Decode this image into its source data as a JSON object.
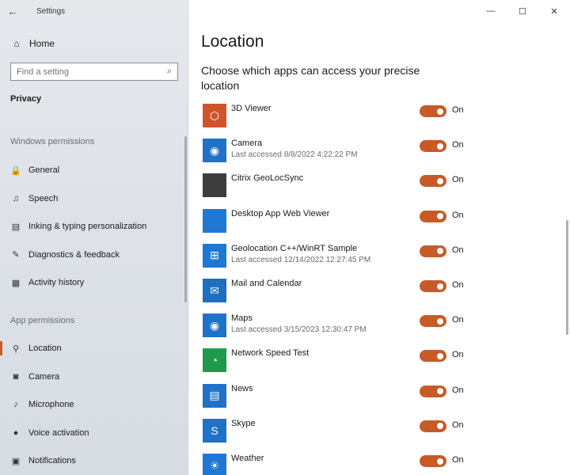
{
  "window": {
    "title": "Settings",
    "back_icon": "back-arrow-icon",
    "controls": {
      "minimize": "—",
      "maximize": "☐",
      "close": "✕"
    }
  },
  "sidebar": {
    "home_label": "Home",
    "search_placeholder": "Find a setting",
    "section": "Privacy",
    "groups": [
      {
        "header": "Windows permissions",
        "items": [
          {
            "label": "General",
            "icon": "lock-icon",
            "glyph": "🔒"
          },
          {
            "label": "Speech",
            "icon": "speech-icon",
            "glyph": "♫"
          },
          {
            "label": "Inking & typing personalization",
            "icon": "clipboard-icon",
            "glyph": "▤"
          },
          {
            "label": "Diagnostics & feedback",
            "icon": "diagnostics-icon",
            "glyph": "✎"
          },
          {
            "label": "Activity history",
            "icon": "activity-icon",
            "glyph": "▦"
          }
        ]
      },
      {
        "header": "App permissions",
        "items": [
          {
            "label": "Location",
            "icon": "location-icon",
            "glyph": "⚲",
            "active": true
          },
          {
            "label": "Camera",
            "icon": "camera-icon",
            "glyph": "◙"
          },
          {
            "label": "Microphone",
            "icon": "microphone-icon",
            "glyph": "♪"
          },
          {
            "label": "Voice activation",
            "icon": "voice-icon",
            "glyph": "●"
          },
          {
            "label": "Notifications",
            "icon": "notifications-icon",
            "glyph": "▣"
          }
        ]
      }
    ]
  },
  "main": {
    "title": "Location",
    "subheading": "Choose which apps can access your precise location",
    "apps": [
      {
        "name": "3D Viewer",
        "sub": "",
        "state": "On",
        "color": "#d0542a",
        "glyph": "⬡",
        "icon": "3d-viewer-icon"
      },
      {
        "name": "Camera",
        "sub": "Last accessed 8/8/2022 4:22:22 PM",
        "state": "On",
        "color": "#1e72c8",
        "glyph": "◉",
        "icon": "camera-app-icon"
      },
      {
        "name": "Citrix GeoLocSync",
        "sub": "",
        "state": "On",
        "color": "#3c3c3c",
        "glyph": "",
        "icon": "citrix-icon"
      },
      {
        "name": "Desktop App Web Viewer",
        "sub": "",
        "state": "On",
        "color": "#1e78d4",
        "glyph": "",
        "icon": "web-viewer-icon"
      },
      {
        "name": "Geolocation C++/WinRT Sample",
        "sub": "Last accessed 12/14/2022 12:27:45 PM",
        "state": "On",
        "color": "#1e78d4",
        "glyph": "⊞",
        "icon": "windows-logo-icon"
      },
      {
        "name": "Mail and Calendar",
        "sub": "",
        "state": "On",
        "color": "#1e6fc0",
        "glyph": "✉",
        "icon": "mail-icon"
      },
      {
        "name": "Maps",
        "sub": "Last accessed 3/15/2023 12:30:47 PM",
        "state": "On",
        "color": "#1e72c8",
        "glyph": "◉",
        "icon": "maps-icon"
      },
      {
        "name": "Network Speed Test",
        "sub": "",
        "state": "On",
        "color": "#1f9a4c",
        "glyph": "◔",
        "icon": "speed-test-icon"
      },
      {
        "name": "News",
        "sub": "",
        "state": "On",
        "color": "#1e72c8",
        "glyph": "▤",
        "icon": "news-icon"
      },
      {
        "name": "Skype",
        "sub": "",
        "state": "On",
        "color": "#1e72c8",
        "glyph": "S",
        "icon": "skype-icon"
      },
      {
        "name": "Weather",
        "sub": "",
        "state": "On",
        "color": "#1e78d4",
        "glyph": "☀",
        "icon": "weather-icon"
      }
    ]
  }
}
